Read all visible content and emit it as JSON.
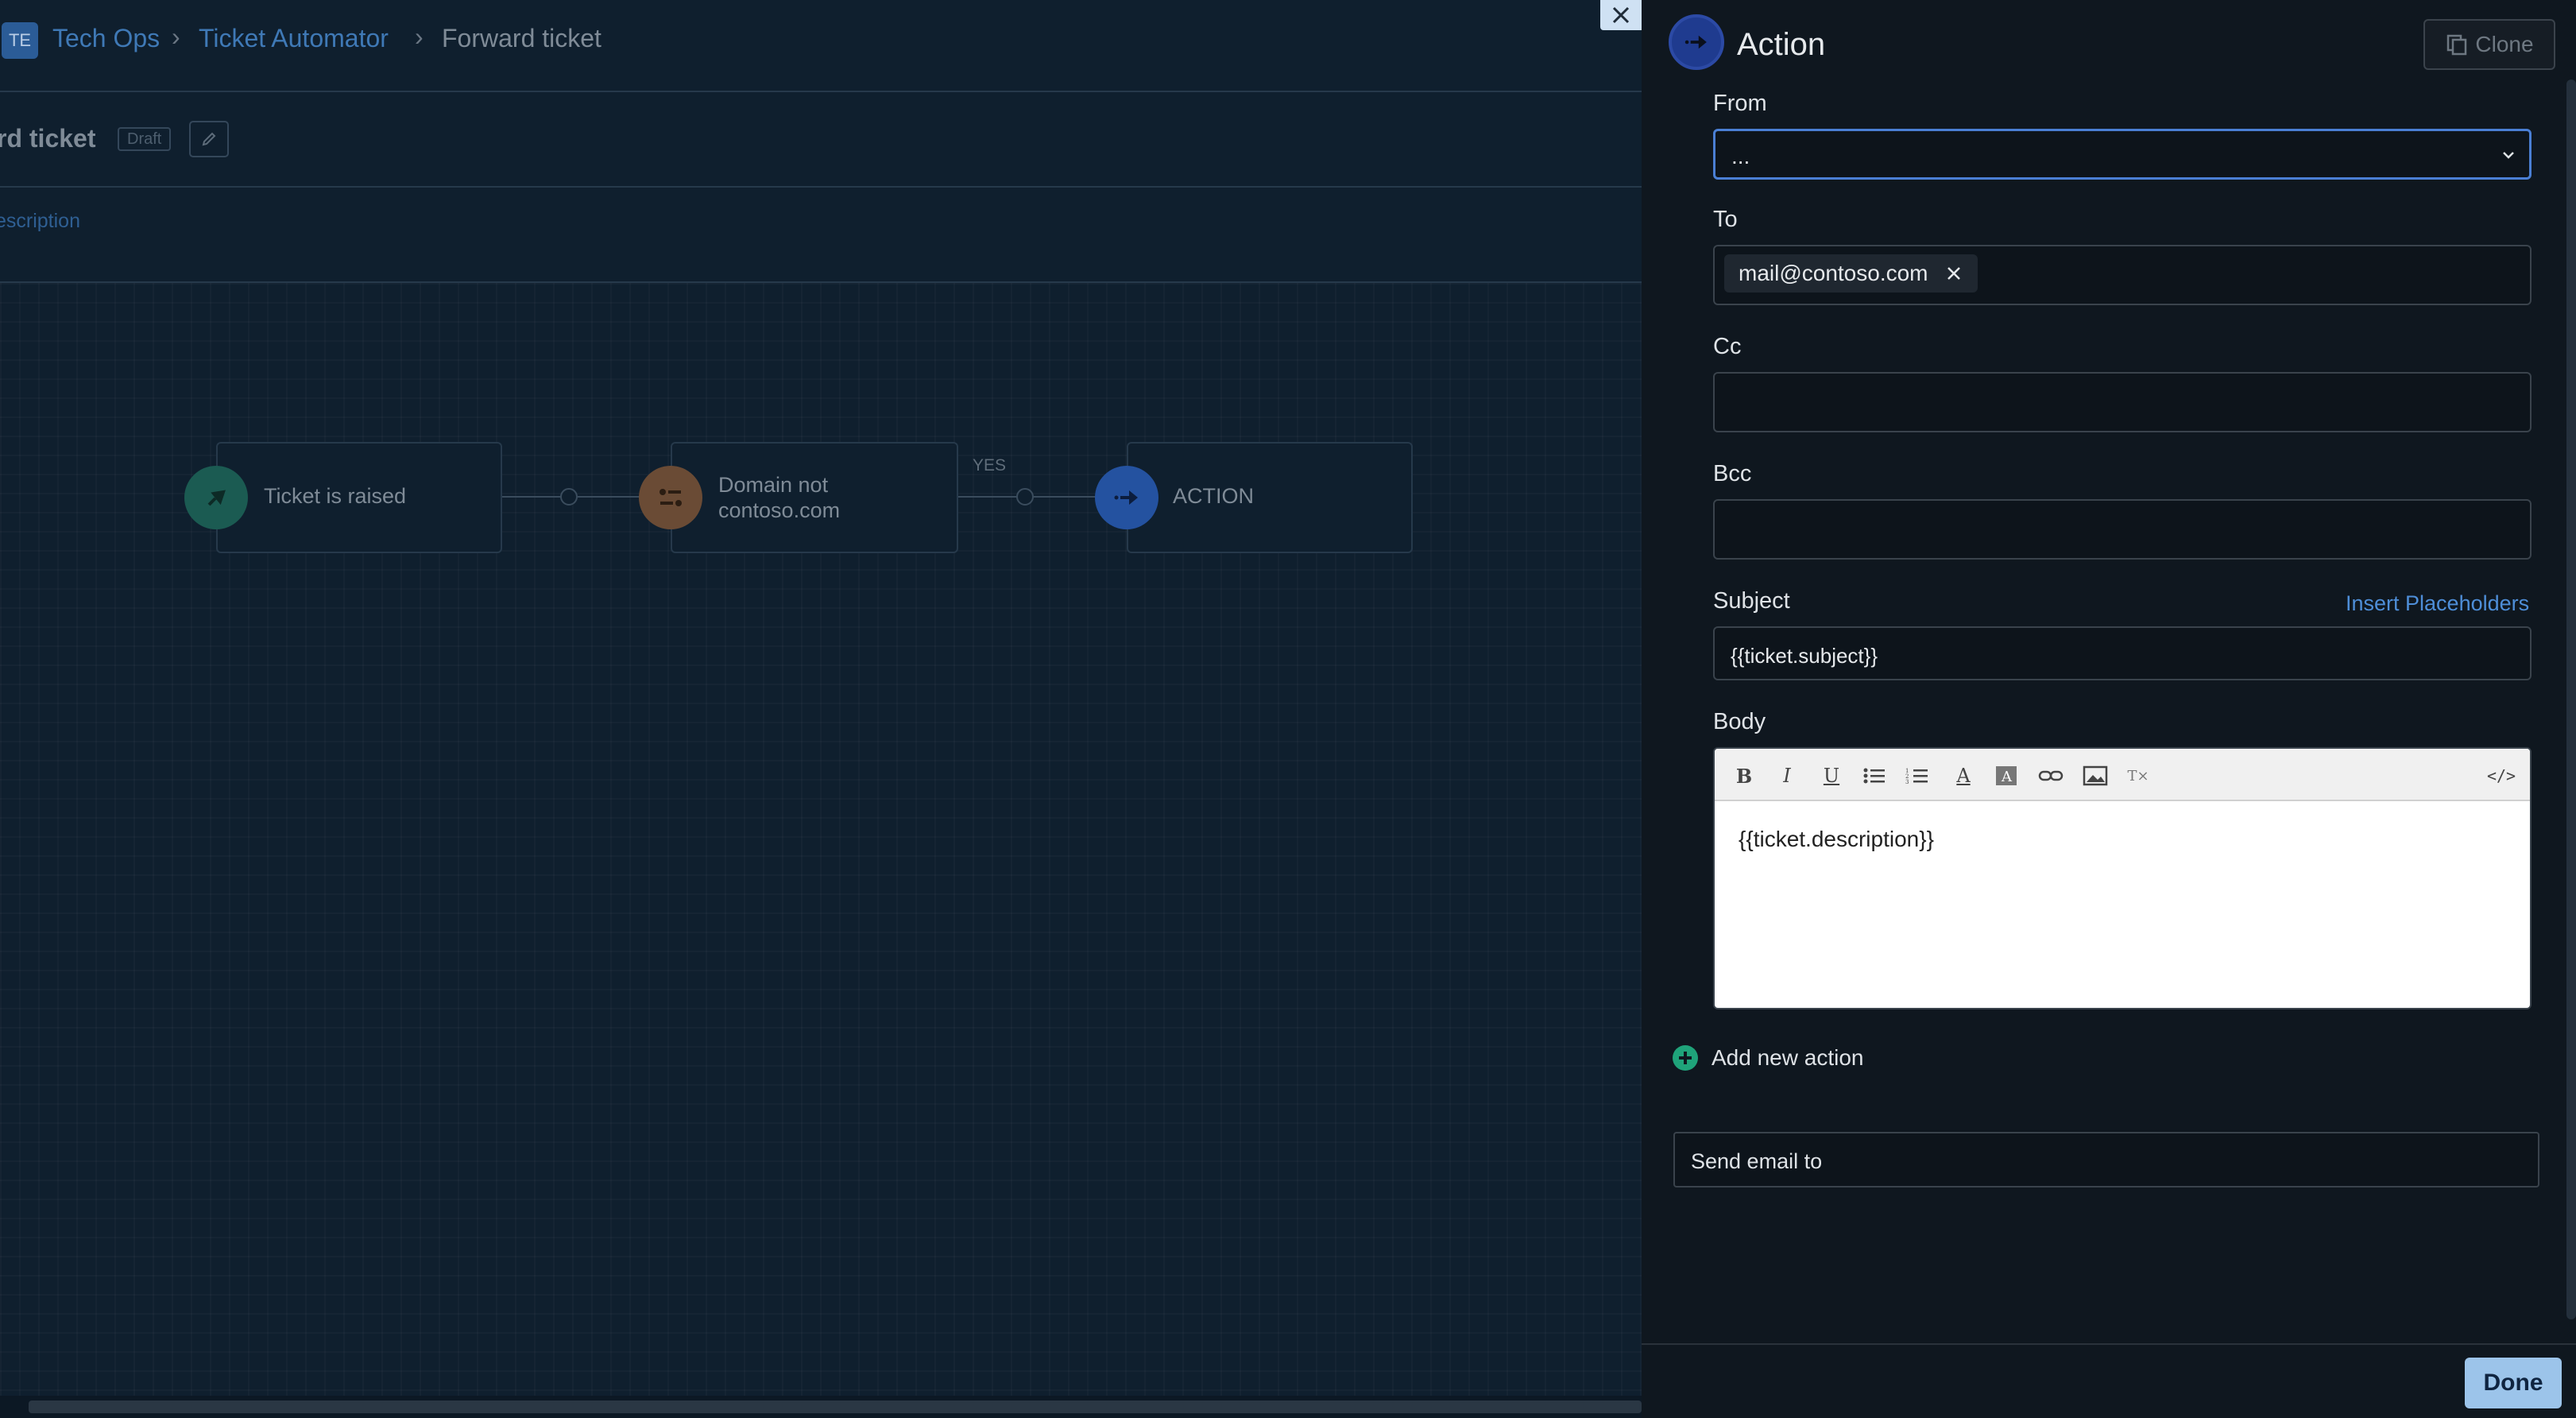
{
  "breadcrumb": {
    "avatar_initials": "TE",
    "items": [
      "Tech Ops",
      "Ticket Automator",
      "Forward ticket"
    ]
  },
  "workflow": {
    "title": "rd ticket",
    "status_badge": "Draft",
    "description_link": "escription",
    "nodes": [
      {
        "label_line1": "Ticket is raised",
        "label_line2": "",
        "color": "#1b5b52"
      },
      {
        "label_line1": "Domain not",
        "label_line2": "contoso.com",
        "color": "#6a4b35"
      },
      {
        "label_line1": "ACTION",
        "label_line2": "",
        "color": "#2452a0"
      }
    ],
    "edge_label": "YES"
  },
  "panel": {
    "title": "Action",
    "clone_label": "Clone",
    "from": {
      "label": "From",
      "value": "..."
    },
    "to": {
      "label": "To",
      "tags": [
        "mail@contoso.com"
      ]
    },
    "cc": {
      "label": "Cc",
      "value": ""
    },
    "bcc": {
      "label": "Bcc",
      "value": ""
    },
    "subject": {
      "label": "Subject",
      "value": "{{ticket.subject}}",
      "insert_link": "Insert Placeholders"
    },
    "body": {
      "label": "Body",
      "content": "{{ticket.description}}",
      "toolbar": [
        "bold-icon",
        "italic-icon",
        "underline-icon",
        "bullet-list-icon",
        "numbered-list-icon",
        "text-color-icon",
        "background-color-icon",
        "link-icon",
        "image-icon",
        "clear-format-icon",
        "source-code-icon"
      ]
    },
    "add_action_label": "Add new action",
    "send_email_value": "Send email to",
    "done_label": "Done"
  },
  "colors": {
    "accent": "#4a7fd4",
    "link": "#4e8ed8",
    "done_button": "#9cc4ea",
    "add_icon": "#1fa37a"
  }
}
